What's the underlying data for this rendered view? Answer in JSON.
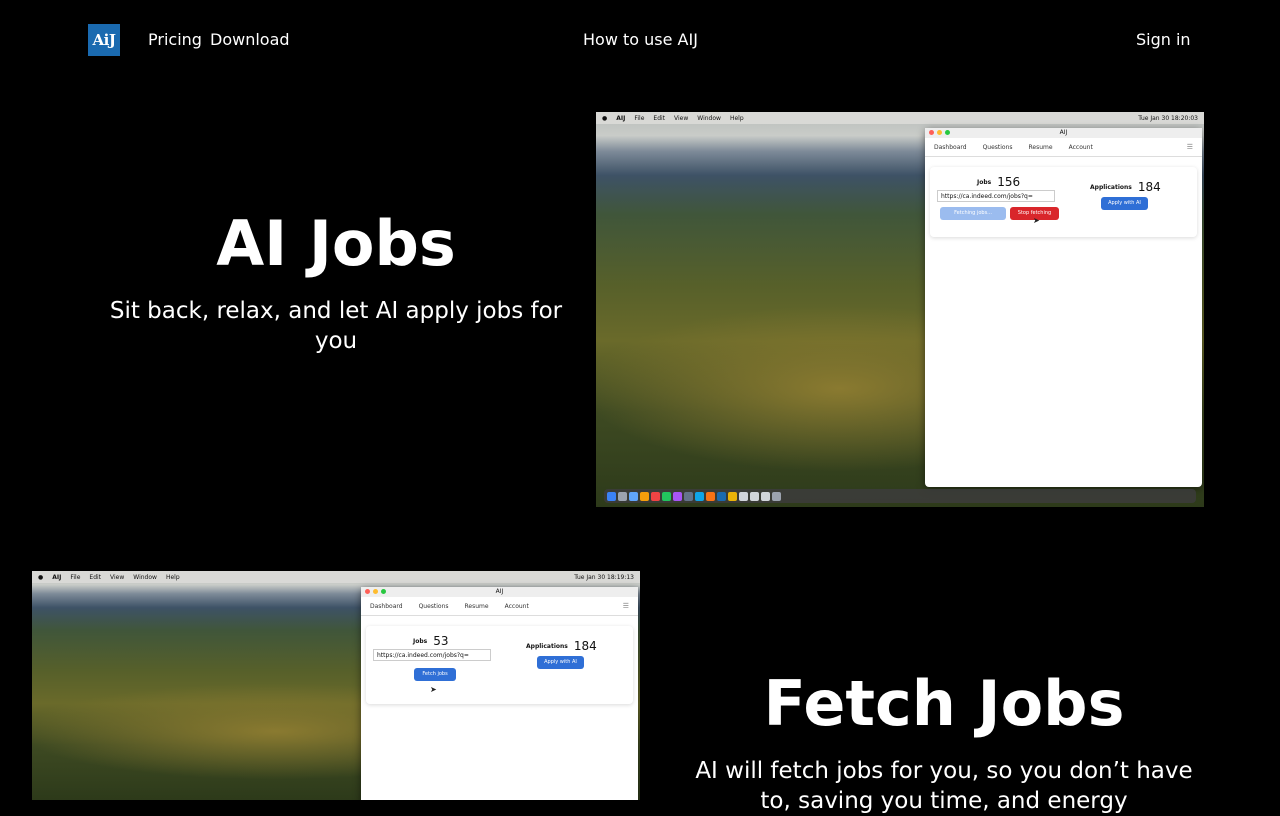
{
  "nav": {
    "logo": "AiJ",
    "pricing": "Pricing",
    "download": "Download",
    "how_to": "How to use AIJ",
    "sign_in": "Sign in",
    "logo_color": "#1a6ab0"
  },
  "hero": {
    "title": "AI Jobs",
    "subtitle": "Sit back, relax, and let AI apply jobs for you"
  },
  "fetch": {
    "title": "Fetch Jobs",
    "subtitle": "AI will fetch jobs for you, so you don’t have to, saving you time, and energy"
  },
  "screenshot1": {
    "menubar": {
      "app": "AIJ",
      "file": "File",
      "edit": "Edit",
      "view": "View",
      "window": "Window",
      "help": "Help",
      "clock": "Tue Jan 30  18:20:03"
    },
    "window_title": "AIJ",
    "tabs": {
      "dashboard": "Dashboard",
      "questions": "Questions",
      "resume": "Resume",
      "account": "Account"
    },
    "jobs_label": "Jobs",
    "jobs_count": "156",
    "url": "https://ca.indeed.com/jobs?q=",
    "fetching_label": "Fetching jobs...",
    "stop_label": "Stop fetching",
    "applications_label": "Applications",
    "applications_count": "184",
    "apply_label": "Apply with AI"
  },
  "screenshot2": {
    "menubar": {
      "app": "AIJ",
      "file": "File",
      "edit": "Edit",
      "view": "View",
      "window": "Window",
      "help": "Help",
      "clock": "Tue Jan 30  18:19:13"
    },
    "window_title": "AIJ",
    "tabs": {
      "dashboard": "Dashboard",
      "questions": "Questions",
      "resume": "Resume",
      "account": "Account"
    },
    "jobs_label": "Jobs",
    "jobs_count": "53",
    "url": "https://ca.indeed.com/jobs?q=",
    "fetch_label": "Fetch jobs",
    "applications_label": "Applications",
    "applications_count": "184",
    "apply_label": "Apply with AI"
  }
}
